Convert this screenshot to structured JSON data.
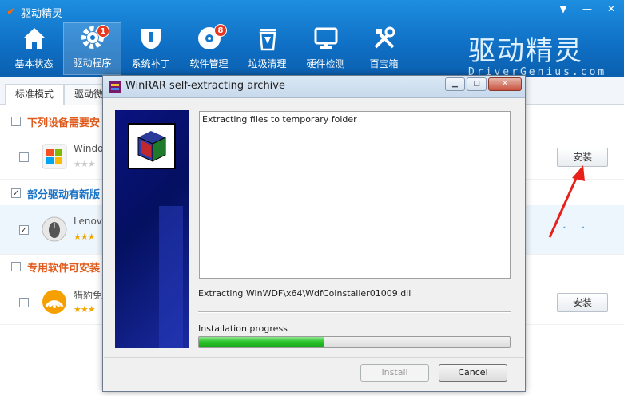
{
  "app": {
    "title": "驱动精灵",
    "window_controls": [
      "▼",
      "—",
      "✕"
    ]
  },
  "nav": [
    {
      "label": "基本状态",
      "icon": "home-icon",
      "badge": null,
      "active": false
    },
    {
      "label": "驱动程序",
      "icon": "gear-icon",
      "badge": "1",
      "active": true
    },
    {
      "label": "系统补丁",
      "icon": "shield-icon",
      "badge": null,
      "active": false
    },
    {
      "label": "软件管理",
      "icon": "disc-icon",
      "badge": "8",
      "active": false
    },
    {
      "label": "垃圾清理",
      "icon": "recycle-bin-icon",
      "badge": null,
      "active": false
    },
    {
      "label": "硬件检测",
      "icon": "monitor-icon",
      "badge": null,
      "active": false
    },
    {
      "label": "百宝箱",
      "icon": "tools-icon",
      "badge": null,
      "active": false
    }
  ],
  "brand": {
    "main": "驱动精灵",
    "sub": "DriverGenius.com"
  },
  "tabs": {
    "standard": "标准模式",
    "second": "驱动微"
  },
  "sections": {
    "s1": "下列设备需要安",
    "s2": "部分驱动有新版",
    "s3": "专用软件可安装"
  },
  "rows": [
    {
      "name": "Windo",
      "install": "安装",
      "checked": false,
      "rating": "gray"
    },
    {
      "name": "Lenov",
      "install": "",
      "checked": true,
      "rating": "gold"
    },
    {
      "name": "猎豹免",
      "install": "安装",
      "checked": false,
      "rating": "gold"
    }
  ],
  "winrar": {
    "title": "WinRAR self-extracting archive",
    "log": "Extracting files to temporary folder",
    "current_file": "Extracting WinWDF\\x64\\WdfCoInstaller01009.dll",
    "progress_label": "Installation progress",
    "progress": 0.4,
    "install_label": "Install",
    "cancel_label": "Cancel",
    "controls": {
      "minimize": "▁",
      "maximize": "□",
      "close": "✕"
    }
  }
}
